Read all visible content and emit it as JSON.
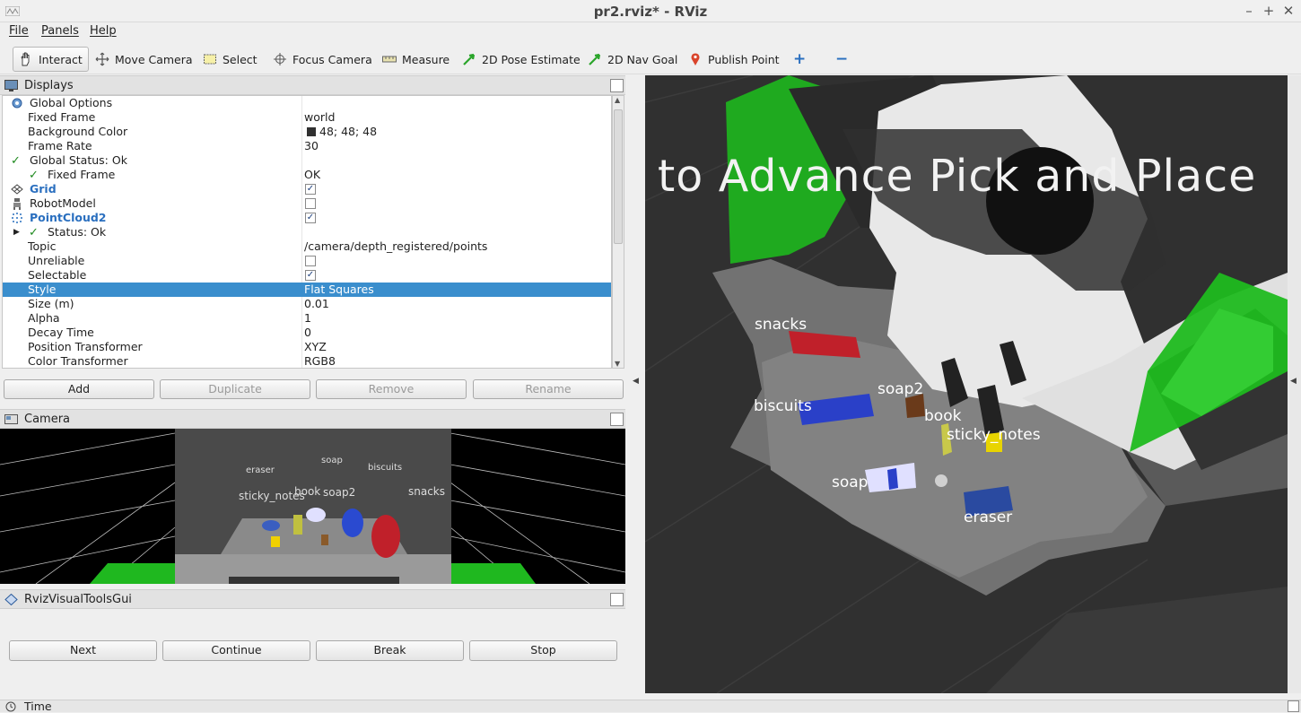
{
  "window": {
    "title": "pr2.rviz* - RViz",
    "controls": [
      "–",
      "+",
      "✕"
    ]
  },
  "menu": [
    "File",
    "Panels",
    "Help"
  ],
  "toolbar": {
    "tools": [
      {
        "name": "interact",
        "label": "Interact",
        "icon": "hand-icon",
        "active": true
      },
      {
        "name": "move-camera",
        "label": "Move Camera",
        "icon": "move-camera-icon"
      },
      {
        "name": "select",
        "label": "Select",
        "icon": "select-rect-icon"
      },
      {
        "name": "focus-camera",
        "label": "Focus Camera",
        "icon": "crosshair-icon"
      },
      {
        "name": "measure",
        "label": "Measure",
        "icon": "ruler-icon"
      },
      {
        "name": "2d-pose-estimate",
        "label": "2D Pose Estimate",
        "icon": "green-arrow-icon"
      },
      {
        "name": "2d-nav-goal",
        "label": "2D Nav Goal",
        "icon": "green-arrow-icon"
      },
      {
        "name": "publish-point",
        "label": "Publish Point",
        "icon": "map-pin-icon"
      }
    ],
    "add_tool": "+",
    "remove_tool": "−"
  },
  "displays": {
    "title": "Displays",
    "rows": [
      {
        "name": "Global Options",
        "value": ""
      },
      {
        "name": "Fixed Frame",
        "value": "world"
      },
      {
        "name": "Background Color",
        "value": "48; 48; 48"
      },
      {
        "name": "Frame Rate",
        "value": "30"
      },
      {
        "name": "Global Status: Ok",
        "value": ""
      },
      {
        "name": "Fixed Frame",
        "value": "OK"
      },
      {
        "name": "Grid",
        "value": "✓"
      },
      {
        "name": "RobotModel",
        "value": ""
      },
      {
        "name": "PointCloud2",
        "value": "✓"
      },
      {
        "name": "Status: Ok",
        "value": ""
      },
      {
        "name": "Topic",
        "value": "/camera/depth_registered/points"
      },
      {
        "name": "Unreliable",
        "value": ""
      },
      {
        "name": "Selectable",
        "value": "✓"
      },
      {
        "name": "Style",
        "value": "Flat Squares"
      },
      {
        "name": "Size (m)",
        "value": "0.01"
      },
      {
        "name": "Alpha",
        "value": "1"
      },
      {
        "name": "Decay Time",
        "value": "0"
      },
      {
        "name": "Position Transformer",
        "value": "XYZ"
      },
      {
        "name": "Color Transformer",
        "value": "RGB8"
      }
    ],
    "background_color_hex": "#303030",
    "selected_color": "#3a8ecd",
    "buttons": {
      "add": "Add",
      "duplicate": "Duplicate",
      "remove": "Remove",
      "rename": "Rename"
    }
  },
  "camera_panel": {
    "title": "Camera",
    "labels": [
      "eraser",
      "soap",
      "biscuits",
      "sticky_notes",
      "book",
      "soap2",
      "snacks"
    ]
  },
  "visual_tools": {
    "title": "RvizVisualToolsGui",
    "buttons": {
      "next": "Next",
      "continue": "Continue",
      "break": "Break",
      "stop": "Stop"
    }
  },
  "time_panel": {
    "title": "Time"
  },
  "view3d": {
    "banner": "to Advance Pick and Place",
    "labels": {
      "snacks": "snacks",
      "biscuits": "biscuits",
      "soap2": "soap2",
      "book": "book",
      "sticky_notes": "sticky_notes",
      "soap": "soap",
      "eraser": "eraser"
    }
  }
}
